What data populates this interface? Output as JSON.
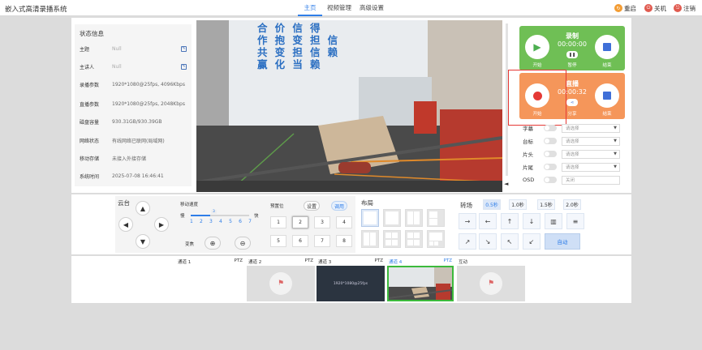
{
  "app": {
    "title": "嵌入式高清录播系统"
  },
  "nav": {
    "tabs": [
      {
        "label": "主页"
      },
      {
        "label": "视频管理"
      },
      {
        "label": "高级设置"
      }
    ]
  },
  "top_right": {
    "restart": "重启",
    "shutdown": "关机",
    "logout": "注销"
  },
  "status": {
    "title": "状态信息",
    "rows": [
      {
        "label": "主题",
        "value": "Null"
      },
      {
        "label": "主讲人",
        "value": "Null"
      },
      {
        "label": "录播参数",
        "value": "1920*1080@25fps, 4096Kbps"
      },
      {
        "label": "直播参数",
        "value": "1920*1080@25fps, 2048Kbps"
      },
      {
        "label": "磁盘容量",
        "value": "930.31GB/930.39GB"
      },
      {
        "label": "网络状态",
        "value": "有线网络已联网(局域网)"
      },
      {
        "label": "移动存储",
        "value": "未接入外接存储"
      },
      {
        "label": "系统时间",
        "value": "2025-07-08 16:46:41"
      }
    ]
  },
  "video": {
    "wall_text": [
      "合",
      "价",
      "信",
      "得",
      "作",
      "抱",
      "变",
      "担",
      "信",
      "共",
      "变",
      "担",
      "信",
      "赖",
      "赢",
      "化",
      "当",
      "赖"
    ]
  },
  "record": {
    "title": "录制",
    "time": "00:00:00",
    "start": "开始",
    "pause": "暂停",
    "stop": "结束"
  },
  "live": {
    "title": "直播",
    "time": "00:00:32",
    "start": "开始",
    "share": "分享",
    "stop": "结束"
  },
  "options": [
    {
      "label": "字幕",
      "select": "请选择"
    },
    {
      "label": "台标",
      "select": "请选择"
    },
    {
      "label": "片头",
      "select": "请选择"
    },
    {
      "label": "片尾",
      "select": "请选择"
    },
    {
      "label": "OSD",
      "select": "关闭"
    }
  ],
  "ptz": {
    "title": "云台",
    "speed_label": "移动速度",
    "slow": "慢",
    "fast": "快",
    "speeds": [
      "1",
      "2",
      "3",
      "4",
      "5",
      "6",
      "7"
    ],
    "speed_value": 3,
    "zoom_label": "变焦",
    "zoom_in": "+",
    "zoom_out": "−"
  },
  "preset": {
    "title": "预置位",
    "set": "设置",
    "call": "调用",
    "numbers": [
      "1",
      "2",
      "3",
      "4",
      "5",
      "6",
      "7",
      "8"
    ]
  },
  "layout": {
    "title": "布局"
  },
  "transition": {
    "title": "转场",
    "times": [
      "0.5秒",
      "1.0秒",
      "1.5秒",
      "2.0秒"
    ],
    "auto": "自动"
  },
  "channels": [
    {
      "name": "通道 1",
      "ptz": "PTZ"
    },
    {
      "name": "通道 2",
      "ptz": "PTZ"
    },
    {
      "name": "通道 3",
      "ptz": "PTZ",
      "screen_text": "1920*1080@25fps"
    },
    {
      "name": "通道 4",
      "ptz": "PTZ"
    },
    {
      "name": "互动",
      "ptz": ""
    }
  ],
  "colors": {
    "accent": "#2f7ee8",
    "record": "#6fbf55",
    "live": "#f5965a",
    "highlight": "#e53935"
  }
}
